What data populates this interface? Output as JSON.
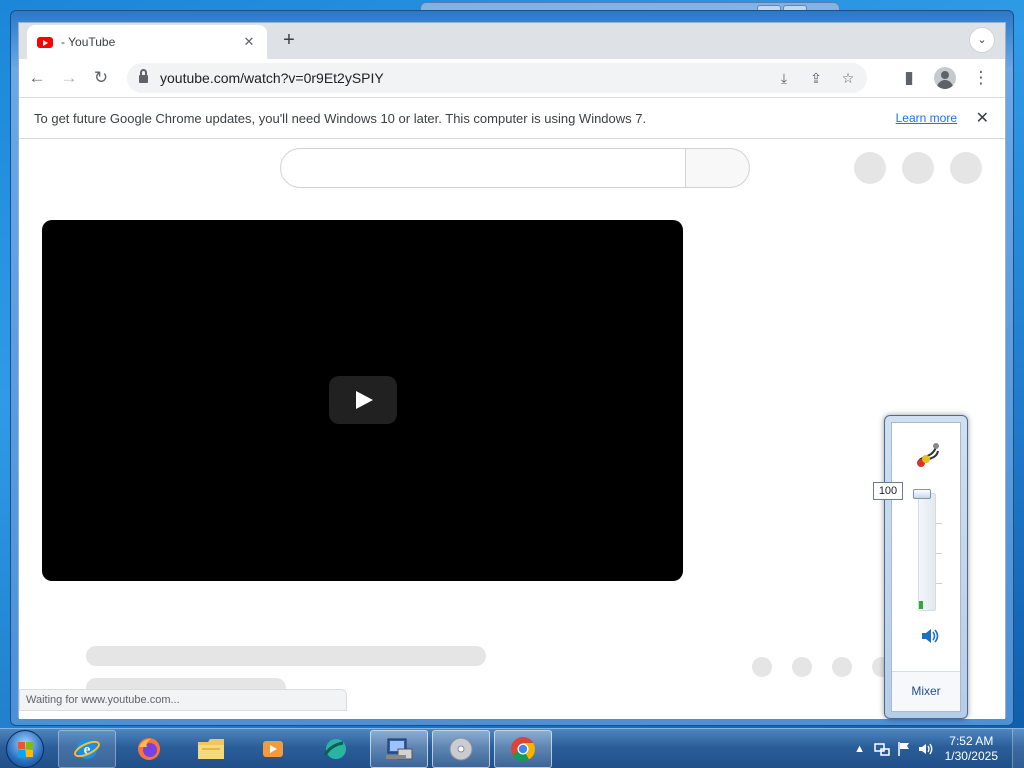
{
  "browser": {
    "tab_title": "- YouTube",
    "new_tab_label": "+",
    "url": "youtube.com/watch?v=0r9Et2ySPIY",
    "infobar_message": "To get future Google Chrome updates, you'll need Windows 10 or later. This computer is using Windows 7.",
    "infobar_link": "Learn more",
    "status_text": "Waiting for www.youtube.com..."
  },
  "volume": {
    "level_readout": "100",
    "level_fraction": 1.0,
    "mixer_label": "Mixer"
  },
  "taskbar": {
    "time": "7:52 AM",
    "date": "1/30/2025",
    "apps": [
      "ie",
      "firefox",
      "explorer",
      "media-player",
      "unknown-app",
      "setup-app",
      "disc-app",
      "chrome"
    ]
  },
  "colors": {
    "youtube_red": "#ff0000",
    "link_blue": "#1a73e8",
    "taskbar_blue": "#2b5f9a"
  }
}
